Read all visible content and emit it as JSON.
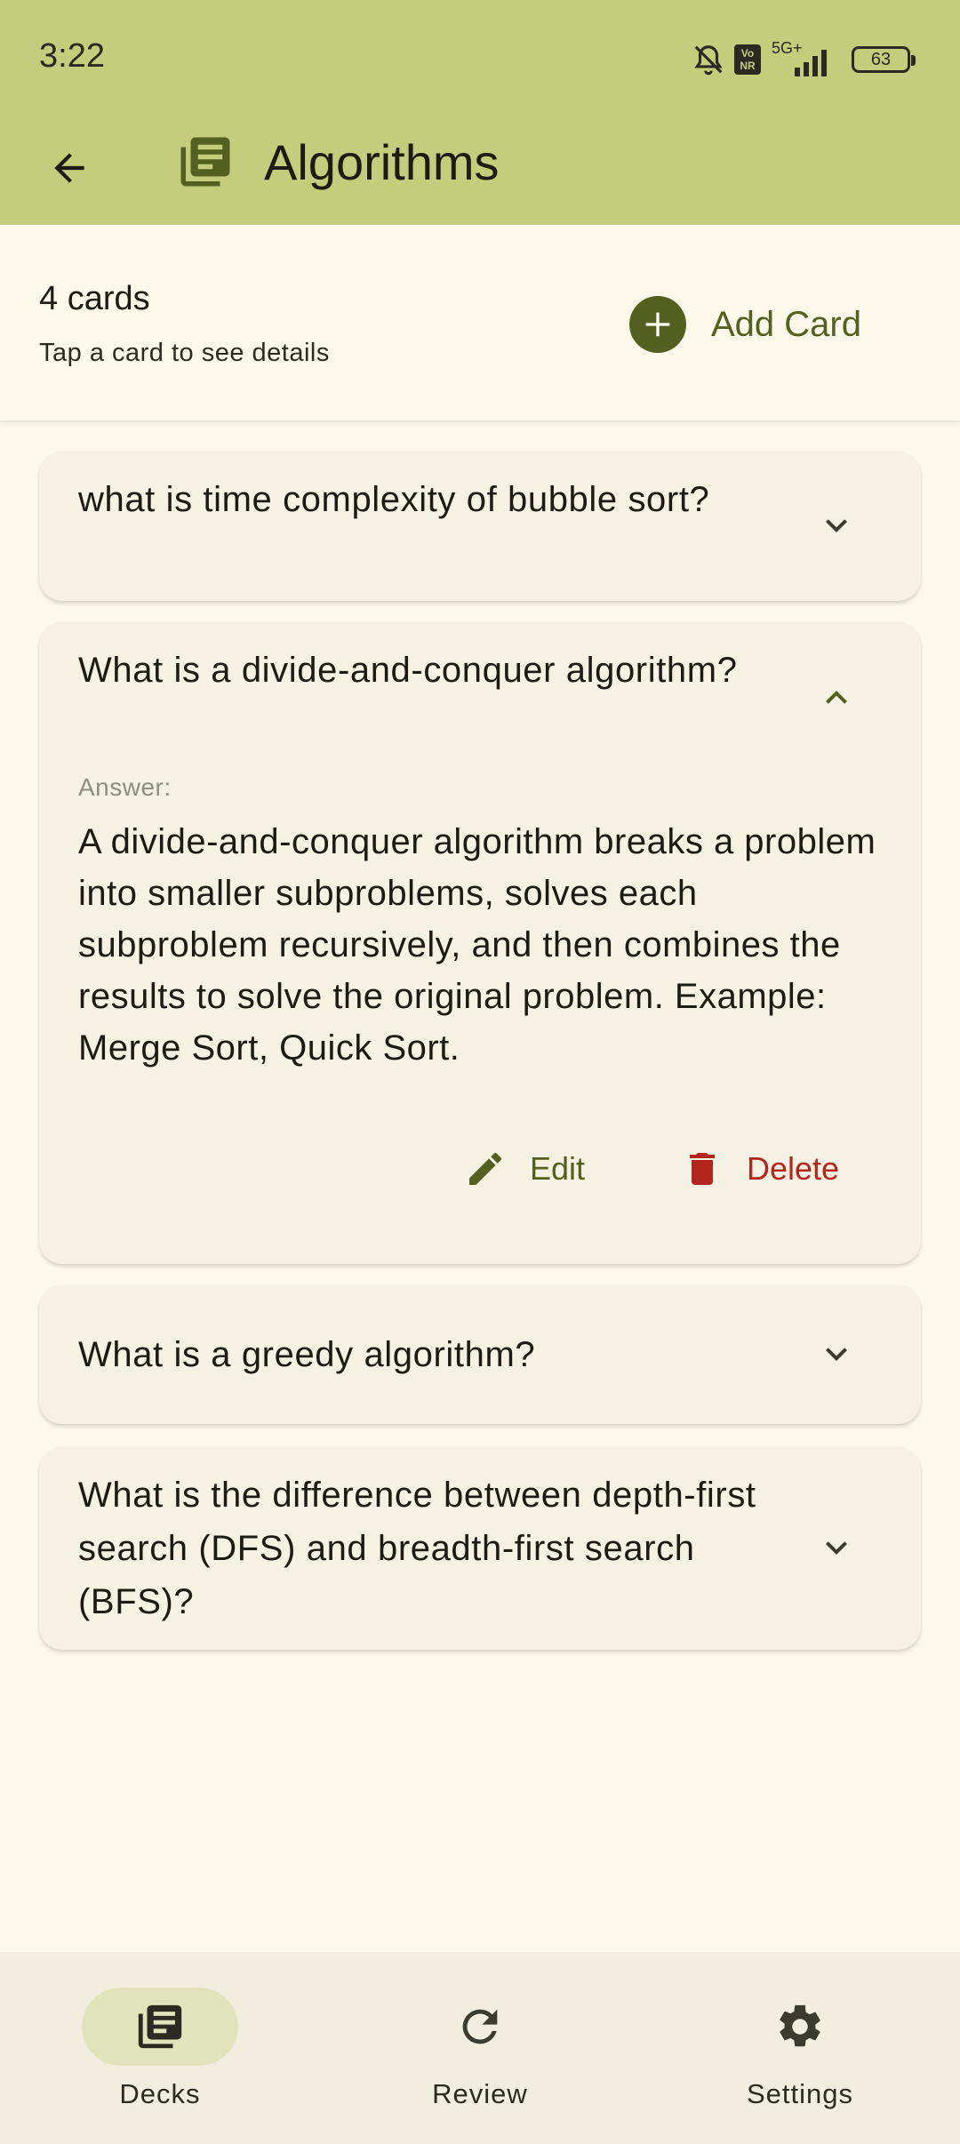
{
  "status": {
    "time": "3:22",
    "network": "5G+",
    "volte": "Vo NR",
    "battery": "63"
  },
  "appbar": {
    "title": "Algorithms"
  },
  "summary": {
    "count": "4 cards",
    "hint": "Tap a card to see details",
    "add_label": "Add Card"
  },
  "cards": [
    {
      "question": "what is time complexity of bubble sort?",
      "expanded": false
    },
    {
      "question": "What is a divide-and-conquer algorithm?",
      "expanded": true,
      "answer_label": "Answer:",
      "answer": "A divide-and-conquer algorithm breaks a problem into smaller subproblems, solves each subproblem recursively, and then combines the results to solve the original problem. Example: Merge Sort, Quick Sort.",
      "edit_label": "Edit",
      "delete_label": "Delete"
    },
    {
      "question": "What is a greedy algorithm?",
      "expanded": false
    },
    {
      "question": "What is the difference between depth-first search (DFS) and breadth-first search (BFS)?",
      "expanded": false
    }
  ],
  "nav": [
    {
      "label": "Decks",
      "icon": "decks-icon",
      "active": true
    },
    {
      "label": "Review",
      "icon": "refresh-icon",
      "active": false
    },
    {
      "label": "Settings",
      "icon": "gear-icon",
      "active": false
    }
  ],
  "colors": {
    "accent": "#54601f",
    "appbar": "#c3cd7b",
    "delete": "#b3261e",
    "background": "#fcf9ea"
  }
}
